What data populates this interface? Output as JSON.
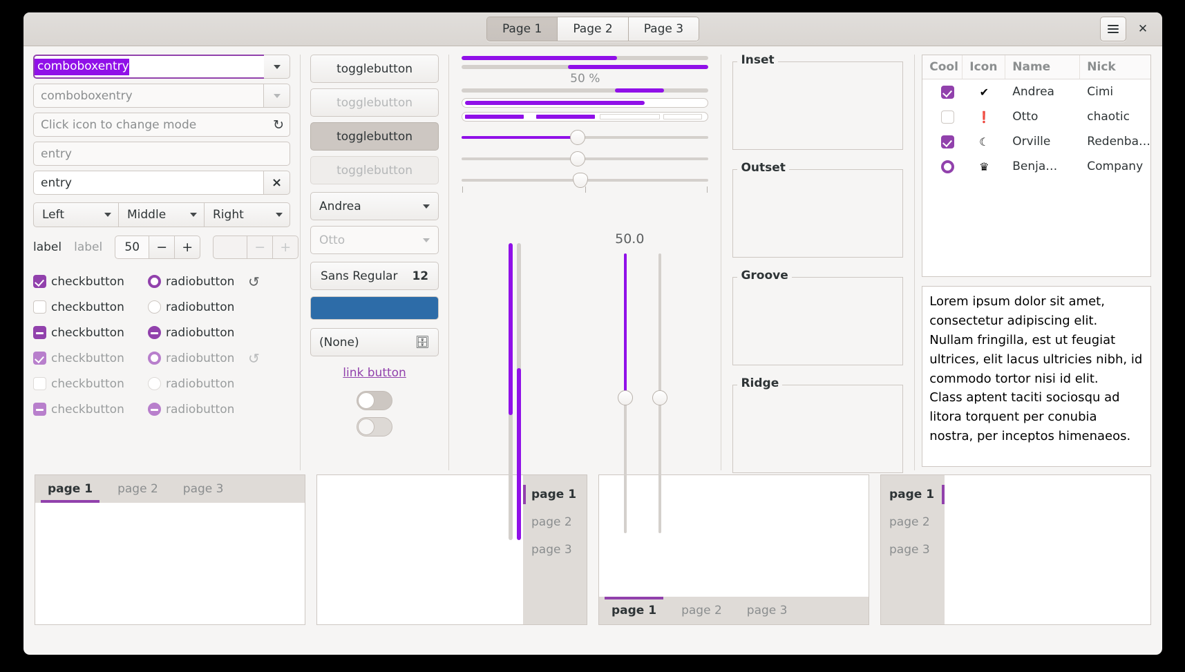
{
  "header": {
    "stack_switcher": [
      {
        "label": "Page 1",
        "active": true
      },
      {
        "label": "Page 2",
        "active": false
      },
      {
        "label": "Page 3",
        "active": false
      }
    ],
    "menu_icon": "hamburger-menu-icon",
    "close_icon": "close-icon",
    "close_glyph": "✕"
  },
  "col1": {
    "combo_entry_selected_text": "comboboxentry",
    "combo_entry_placeholder": "comboboxentry",
    "icon_entry_placeholder": "Click icon to change mode",
    "entry_placeholder": "entry",
    "entry_value": "entry",
    "entry_clear_glyph": "×",
    "buttons": [
      "Left",
      "Middle",
      "Right"
    ],
    "label_enabled": "label",
    "label_disabled": "label",
    "spin_value": "50",
    "spin_minus": "−",
    "spin_plus": "+",
    "spin_disabled_minus": "−",
    "spin_disabled_plus": "+",
    "check_label": "checkbutton",
    "radio_label": "radiobutton",
    "spinner_glyph": "↺",
    "rows": [
      {
        "check": "on",
        "radio": "on",
        "spinner": true,
        "dim": false
      },
      {
        "check": "off",
        "radio": "off",
        "spinner": false,
        "dim": false
      },
      {
        "check": "mixed",
        "radio": "mixed",
        "spinner": false,
        "dim": false
      },
      {
        "check": "on",
        "radio": "on",
        "spinner": true,
        "dim": true
      },
      {
        "check": "off",
        "radio": "off",
        "spinner": false,
        "dim": true
      },
      {
        "check": "mixed",
        "radio": "mixed",
        "spinner": false,
        "dim": true
      }
    ]
  },
  "col2": {
    "toggle1": "togglebutton",
    "toggle2": "togglebutton",
    "toggle3": "togglebutton",
    "toggle4": "togglebutton",
    "combo_value": "Andrea",
    "combo_disabled_value": "Otto",
    "font_name": "Sans Regular",
    "font_size": "12",
    "color_value": "#2d6ca8",
    "file_value": "(None)",
    "file_icon": "folder-icon",
    "link_label": "link button",
    "switch_on_icon": "switch-toggle",
    "switch_off_icon": "switch-toggle-disabled"
  },
  "col3": {
    "progress_1_pct": 63,
    "progress_2_pct": 57,
    "progress_text": "50 %",
    "progress_3_pct": 20,
    "levelbar_pct": 73,
    "levelbar_discrete_segments": [
      38,
      30
    ],
    "scale_1_value": 47,
    "scale_2_value": 47,
    "scale_3_value": 48,
    "marks": [
      "",
      "",
      ""
    ],
    "vscale_value_text": "50.0",
    "vbar_1_pct": 58,
    "vbar_2_pct": 42,
    "vscale_value": 50
  },
  "frames": [
    {
      "title": "Inset"
    },
    {
      "title": "Outset"
    },
    {
      "title": "Groove"
    },
    {
      "title": "Ridge"
    }
  ],
  "treeview": {
    "columns": [
      "Cool",
      "Icon",
      "Name",
      "Nick"
    ],
    "rows": [
      {
        "cool": "check-on",
        "icon": "✔",
        "icon_name": "check-circle-icon",
        "name": "Andrea",
        "nick": "Cimi"
      },
      {
        "cool": "check-off",
        "icon": "❗",
        "icon_name": "warning-icon",
        "name": "Otto",
        "nick": "chaotic"
      },
      {
        "cool": "check-on",
        "icon": "☾",
        "icon_name": "moon-icon",
        "name": "Orville",
        "nick": "Redenba…"
      },
      {
        "cool": "radio-on",
        "icon": "♛",
        "icon_name": "crown-icon",
        "name": "Benja…",
        "nick": "Company"
      }
    ]
  },
  "textview": {
    "paragraph_1": "Lorem ipsum dolor sit amet, consectetur adipiscing elit. Nullam fringilla, est ut feugiat ultrices, elit lacus ultricies nibh, id commodo tortor nisi id elit.",
    "paragraph_2": "Class aptent taciti sociosqu ad litora torquent per conubia nostra, per inceptos himenaeos."
  },
  "notebooks": [
    {
      "position": "top",
      "tabs": [
        {
          "label": "page 1",
          "active": true
        },
        {
          "label": "page 2",
          "active": false
        },
        {
          "label": "page 3",
          "active": false
        }
      ]
    },
    {
      "position": "right",
      "tabs": [
        {
          "label": "page 1",
          "active": true
        },
        {
          "label": "page 2",
          "active": false
        },
        {
          "label": "page 3",
          "active": false
        }
      ]
    },
    {
      "position": "bottom",
      "tabs": [
        {
          "label": "page 1",
          "active": true
        },
        {
          "label": "page 2",
          "active": false
        },
        {
          "label": "page 3",
          "active": false
        }
      ]
    },
    {
      "position": "left",
      "tabs": [
        {
          "label": "page 1",
          "active": true
        },
        {
          "label": "page 2",
          "active": false
        },
        {
          "label": "page 3",
          "active": false
        }
      ]
    }
  ],
  "colors": {
    "accent": "#9141ac",
    "progress": "#9010e8",
    "selection": "#9010e8",
    "bg": "#f6f5f4",
    "border": "#cdc7c2"
  }
}
